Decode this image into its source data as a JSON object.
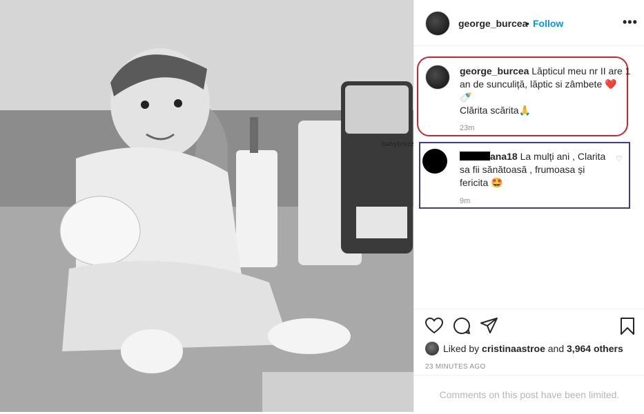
{
  "post": {
    "author": "george_burcea",
    "dot": "•",
    "follow_label": "Follow",
    "more_label": "•••",
    "caption_author": "george_burcea",
    "caption_line1": " Lăpticul meu nr II are 1 an de sunculiță, lăptic si zâmbete ",
    "caption_emoji1": "❤️",
    "caption_emoji2": "🍼",
    "caption_line2": "Clărita scărita",
    "caption_emoji3": "🙏",
    "caption_time": "23m"
  },
  "comment": {
    "author_suffix": "ana18",
    "text": " La mulți ani , Clarita sa fii sănătoasă , frumoasa și fericita ",
    "emoji": "🤩",
    "time": "9m",
    "heart_icon": "♡"
  },
  "actions": {
    "liked_by_prefix": "Liked by ",
    "liked_by_user": "cristinaastroe",
    "and_label": " and ",
    "others_count": "3,964 others",
    "timestamp": "23 MINUTES AGO"
  },
  "footer": {
    "limited_text": "Comments on this post have been limited."
  },
  "photo": {
    "brand_text": "babybrezza"
  },
  "colors": {
    "follow_blue": "#0095f6",
    "highlight_red": "#c9252c",
    "highlight_blue": "#3c3d8f"
  }
}
